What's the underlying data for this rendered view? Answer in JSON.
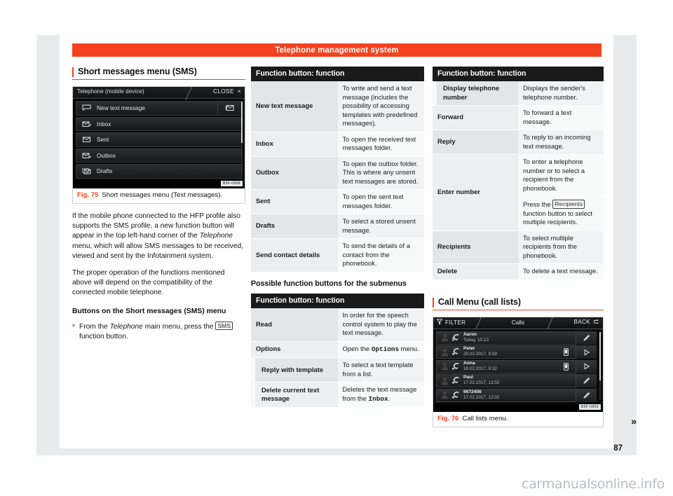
{
  "header": {
    "title": "Telephone management system"
  },
  "page_number": "87",
  "watermark": "carmanualsonline.info",
  "next_marker": "»",
  "left_column": {
    "section_title": "Short messages menu (SMS)",
    "screenshot": {
      "window_title": "Telephone (mobile device)",
      "close_label": "CLOSE",
      "close_icon": "×",
      "image_code": "B5F-0898",
      "rows": [
        {
          "label": "New text message",
          "icon": "message-bubble-icon",
          "aux_icon": "new-message-icon"
        },
        {
          "label": "Inbox",
          "icon": "envelope-in-icon"
        },
        {
          "label": "Sent",
          "icon": "envelope-sent-icon"
        },
        {
          "label": "Outbox",
          "icon": "envelope-out-icon"
        },
        {
          "label": "Drafts",
          "icon": "envelope-draft-icon"
        }
      ]
    },
    "figure": {
      "number": "Fig. 75",
      "caption": "Short messages menu (Text messages)."
    },
    "paragraph_1": "If the mobile phone connected to the HFP profile also supports the SMS profile, a new function button will appear in the top left-hand corner of the ",
    "paragraph_1_italic": "Telephone",
    "paragraph_1_end": " menu, which will allow SMS messages to be received, viewed and sent by the Infotainment system.",
    "paragraph_2": "The proper operation of the functions mentioned above will depend on the compatibility of the connected mobile telephone.",
    "sub_heading": "Buttons on the Short messages (SMS) menu",
    "bullet_start": "From the ",
    "bullet_italic": "Telephone",
    "bullet_mid": " main menu, press the ",
    "bullet_key": "SMS",
    "bullet_end": " function button."
  },
  "mid_column": {
    "table_1": {
      "header": "Function button: function",
      "rows": [
        {
          "key": "New text message",
          "value": "To write and send a text message (includes the possibility of accessing templates with predefined messages)."
        },
        {
          "key": "Inbox",
          "value": "To open the received text messages folder."
        },
        {
          "key": "Outbox",
          "value": "To open the outbox folder. This is where any unsent text messages are stored."
        },
        {
          "key": "Sent",
          "value": "To open the sent text messages folder."
        },
        {
          "key": "Drafts",
          "value": "To select a stored unsent message."
        },
        {
          "key": "Send contact details",
          "value": "To send the details of a contact from the phonebook."
        }
      ]
    },
    "sub_heading": "Possible function buttons for the submenus",
    "table_2": {
      "header": "Function button: function",
      "rows": [
        {
          "key": "Read",
          "value": "In order for the speech control system to play the text message."
        },
        {
          "key": "Options",
          "value_pre": "Open the ",
          "value_mono": "Options",
          "value_post": " menu."
        },
        {
          "key": "Reply with template",
          "value": "To select a text template from a list.",
          "indent": true
        },
        {
          "key": "Delete current text message",
          "value_pre": "Deletes the text message from the ",
          "value_mono": "Inbox",
          "value_post": ".",
          "indent": true
        }
      ]
    }
  },
  "right_column": {
    "table_3": {
      "header": "Function button: function",
      "rows": [
        {
          "key": "Display telephone number",
          "value": "Displays the sender's telephone number.",
          "indent": true
        },
        {
          "key": "Forward",
          "value": "To forward a text message."
        },
        {
          "key": "Reply",
          "value": "To reply to an incoming text message."
        },
        {
          "key": "Enter number",
          "value": "To enter a telephone number or to select a recipient from the phonebook."
        },
        {
          "key": "",
          "value_pre": "Press the ",
          "value_key": "Recipients",
          "value_post": " function button to select multiple recipients."
        },
        {
          "key": "Recipients",
          "value": "To select multiple recipients from the phonebook."
        },
        {
          "key": "Delete",
          "value": "To delete a text message."
        }
      ]
    },
    "section_title": "Call Menu (call lists)",
    "screenshot": {
      "filter_label": "FILTER",
      "title": "Calls",
      "back_label": "BACK",
      "image_code": "B5F-0899",
      "rows": [
        {
          "name": "Aaron",
          "date": "Today, 10:13",
          "call_icon": "call-incoming-icon",
          "device_icon": "",
          "action_icon": "edit-pencil-icon"
        },
        {
          "name": "Peter",
          "date": "20.02.2017, 9:59",
          "call_icon": "call-outgoing-icon",
          "device_icon": "mobile-phone-icon",
          "action_icon": "play-arrow-icon"
        },
        {
          "name": "Anna",
          "date": "18.02.2017, 9:32",
          "call_icon": "call-outgoing-icon",
          "device_icon": "mobile-phone-icon",
          "action_icon": "play-arrow-icon"
        },
        {
          "name": "Paul",
          "date": "17.02.2017, 13:52",
          "call_icon": "call-outgoing-icon",
          "device_icon": "",
          "action_icon": "edit-pencil-icon"
        },
        {
          "name": "6672456",
          "date": "17.02.2017, 12:02",
          "call_icon": "call-outgoing-icon",
          "device_icon": "",
          "action_icon": "edit-pencil-icon"
        }
      ]
    },
    "figure": {
      "number": "Fig. 76",
      "caption": "Call lists menu."
    }
  },
  "colors": {
    "accent": "#f4411e",
    "table_header_bg": "#1a1a1a",
    "page_bg": "#e8eaec"
  }
}
